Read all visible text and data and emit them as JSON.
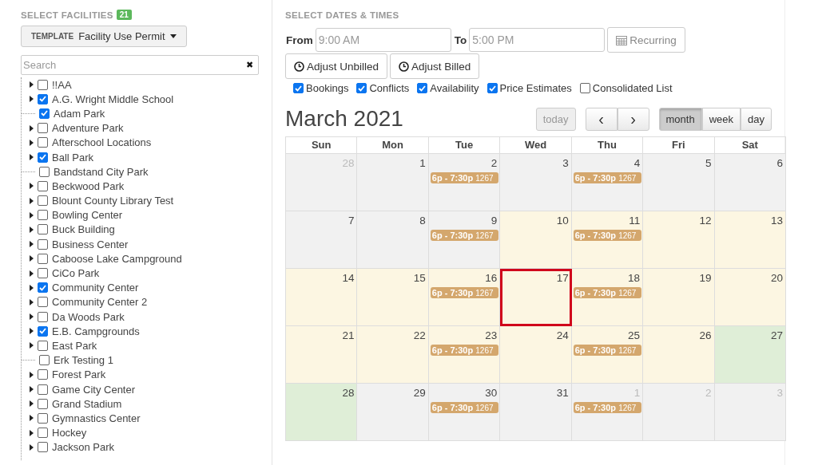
{
  "facilities": {
    "heading": "SELECT FACILITIES",
    "count": "21",
    "template": {
      "label": "TEMPLATE",
      "value": "Facility Use Permit"
    },
    "search": {
      "placeholder": "Search",
      "clear": "✖"
    },
    "items": [
      {
        "label": "!!AA",
        "checked": false,
        "expandable": true
      },
      {
        "label": "A.G. Wright Middle School",
        "checked": true,
        "expandable": true
      },
      {
        "label": "Adam Park",
        "checked": true,
        "expandable": false
      },
      {
        "label": "Adventure Park",
        "checked": false,
        "expandable": true
      },
      {
        "label": "Afterschool Locations",
        "checked": false,
        "expandable": true
      },
      {
        "label": "Ball Park",
        "checked": true,
        "expandable": true
      },
      {
        "label": "Bandstand City Park",
        "checked": false,
        "expandable": false
      },
      {
        "label": "Beckwood Park",
        "checked": false,
        "expandable": true
      },
      {
        "label": "Blount County Library Test",
        "checked": false,
        "expandable": true
      },
      {
        "label": "Bowling Center",
        "checked": false,
        "expandable": true
      },
      {
        "label": "Buck Building",
        "checked": false,
        "expandable": true
      },
      {
        "label": "Business Center",
        "checked": false,
        "expandable": true
      },
      {
        "label": "Caboose Lake Campground",
        "checked": false,
        "expandable": true
      },
      {
        "label": "CiCo Park",
        "checked": false,
        "expandable": true
      },
      {
        "label": "Community Center",
        "checked": true,
        "expandable": true
      },
      {
        "label": "Community Center 2",
        "checked": false,
        "expandable": true
      },
      {
        "label": "Da Woods Park",
        "checked": false,
        "expandable": true
      },
      {
        "label": "E.B. Campgrounds",
        "checked": true,
        "expandable": true
      },
      {
        "label": "East Park",
        "checked": false,
        "expandable": true
      },
      {
        "label": "Erk Testing 1",
        "checked": false,
        "expandable": false
      },
      {
        "label": "Forest Park",
        "checked": false,
        "expandable": true
      },
      {
        "label": "Game City Center",
        "checked": false,
        "expandable": true
      },
      {
        "label": "Grand Stadium",
        "checked": false,
        "expandable": true
      },
      {
        "label": "Gymnastics Center",
        "checked": false,
        "expandable": true
      },
      {
        "label": "Hockey",
        "checked": false,
        "expandable": true
      },
      {
        "label": "Jackson Park",
        "checked": false,
        "expandable": true
      }
    ]
  },
  "dates": {
    "heading": "SELECT DATES & TIMES",
    "from_label": "From",
    "from_value": "9:00 AM",
    "to_label": "To",
    "to_value": "5:00 PM",
    "recurring": "Recurring",
    "adjust_buttons": [
      "Adjust Unbilled",
      "Adjust Billed"
    ],
    "options": [
      {
        "label": "Bookings",
        "checked": true
      },
      {
        "label": "Conflicts",
        "checked": true
      },
      {
        "label": "Availability",
        "checked": true
      },
      {
        "label": "Price Estimates",
        "checked": true
      },
      {
        "label": "Consolidated List",
        "checked": false
      }
    ]
  },
  "calendar": {
    "title": "March 2021",
    "today": "today",
    "prev": "‹",
    "next": "›",
    "views": [
      {
        "label": "month",
        "selected": true
      },
      {
        "label": "week",
        "selected": false
      },
      {
        "label": "day",
        "selected": false
      }
    ],
    "weekdays": [
      "Sun",
      "Mon",
      "Tue",
      "Wed",
      "Thu",
      "Fri",
      "Sat"
    ],
    "weeks": [
      [
        {
          "day": "28",
          "other_month": true,
          "kind": "past",
          "selected": false
        },
        {
          "day": "1",
          "other_month": false,
          "kind": "past",
          "selected": false
        },
        {
          "day": "2",
          "other_month": false,
          "kind": "past",
          "selected": false,
          "events": [
            {
              "time": "6p - 7:30p",
              "code": "1267"
            }
          ]
        },
        {
          "day": "3",
          "other_month": false,
          "kind": "past",
          "selected": false
        },
        {
          "day": "4",
          "other_month": false,
          "kind": "past",
          "selected": false,
          "events": [
            {
              "time": "6p - 7:30p",
              "code": "1267"
            }
          ]
        },
        {
          "day": "5",
          "other_month": false,
          "kind": "past",
          "selected": false
        },
        {
          "day": "6",
          "other_month": false,
          "kind": "past",
          "selected": false
        }
      ],
      [
        {
          "day": "7",
          "other_month": false,
          "kind": "past",
          "selected": false
        },
        {
          "day": "8",
          "other_month": false,
          "kind": "past",
          "selected": false
        },
        {
          "day": "9",
          "other_month": false,
          "kind": "past",
          "selected": false,
          "events": [
            {
              "time": "6p - 7:30p",
              "code": "1267"
            }
          ]
        },
        {
          "day": "10",
          "other_month": false,
          "kind": "available",
          "selected": false
        },
        {
          "day": "11",
          "other_month": false,
          "kind": "available",
          "selected": false,
          "events": [
            {
              "time": "6p - 7:30p",
              "code": "1267"
            }
          ]
        },
        {
          "day": "12",
          "other_month": false,
          "kind": "available",
          "selected": false
        },
        {
          "day": "13",
          "other_month": false,
          "kind": "available",
          "selected": false
        }
      ],
      [
        {
          "day": "14",
          "other_month": false,
          "kind": "available",
          "selected": false
        },
        {
          "day": "15",
          "other_month": false,
          "kind": "available",
          "selected": false
        },
        {
          "day": "16",
          "other_month": false,
          "kind": "available",
          "selected": false,
          "events": [
            {
              "time": "6p - 7:30p",
              "code": "1267"
            }
          ]
        },
        {
          "day": "17",
          "other_month": false,
          "kind": "available",
          "selected": true
        },
        {
          "day": "18",
          "other_month": false,
          "kind": "available",
          "selected": false,
          "events": [
            {
              "time": "6p - 7:30p",
              "code": "1267"
            }
          ]
        },
        {
          "day": "19",
          "other_month": false,
          "kind": "available",
          "selected": false
        },
        {
          "day": "20",
          "other_month": false,
          "kind": "available",
          "selected": false
        }
      ],
      [
        {
          "day": "21",
          "other_month": false,
          "kind": "available",
          "selected": false
        },
        {
          "day": "22",
          "other_month": false,
          "kind": "available",
          "selected": false
        },
        {
          "day": "23",
          "other_month": false,
          "kind": "available",
          "selected": false,
          "events": [
            {
              "time": "6p - 7:30p",
              "code": "1267"
            }
          ]
        },
        {
          "day": "24",
          "other_month": false,
          "kind": "available",
          "selected": false
        },
        {
          "day": "25",
          "other_month": false,
          "kind": "available",
          "selected": false,
          "events": [
            {
              "time": "6p - 7:30p",
              "code": "1267"
            }
          ]
        },
        {
          "day": "26",
          "other_month": false,
          "kind": "available",
          "selected": false
        },
        {
          "day": "27",
          "other_month": false,
          "kind": "open",
          "selected": false
        }
      ],
      [
        {
          "day": "28",
          "other_month": false,
          "kind": "open",
          "selected": false
        },
        {
          "day": "29",
          "other_month": false,
          "kind": "past",
          "selected": false
        },
        {
          "day": "30",
          "other_month": false,
          "kind": "past",
          "selected": false,
          "events": [
            {
              "time": "6p - 7:30p",
              "code": "1267"
            }
          ]
        },
        {
          "day": "31",
          "other_month": false,
          "kind": "past",
          "selected": false
        },
        {
          "day": "1",
          "other_month": true,
          "kind": "past",
          "selected": false,
          "events": [
            {
              "time": "6p - 7:30p",
              "code": "1267"
            }
          ]
        },
        {
          "day": "2",
          "other_month": true,
          "kind": "past",
          "selected": false
        },
        {
          "day": "3",
          "other_month": true,
          "kind": "past",
          "selected": false
        }
      ]
    ]
  }
}
